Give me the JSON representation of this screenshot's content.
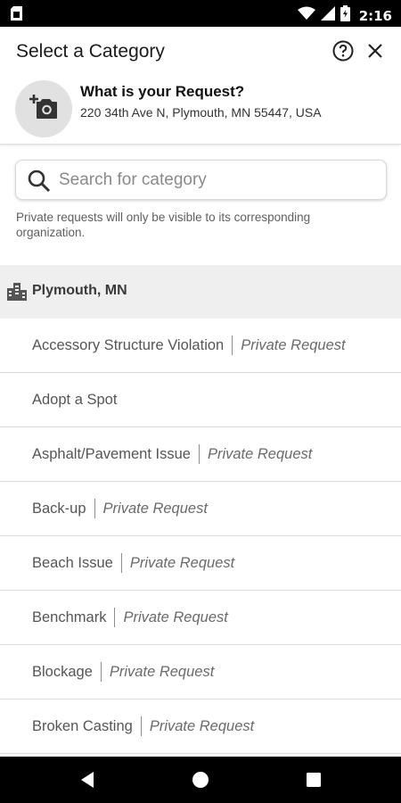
{
  "status_bar": {
    "time": "2:16",
    "icons": [
      "sim-card-icon",
      "wifi-icon",
      "signal-icon",
      "battery-icon"
    ]
  },
  "header": {
    "title": "Select a Category",
    "help_icon": "help-circle-icon",
    "close_icon": "close-icon",
    "photo_icon": "add-photo-icon",
    "request_title": "What is your Request?",
    "request_address": "220 34th Ave N, Plymouth, MN 55447, USA"
  },
  "search": {
    "placeholder": "Search for category",
    "value": ""
  },
  "note": "Private requests will only be visible to its corresponding organization.",
  "organization": {
    "name": "Plymouth, MN",
    "icon": "city-buildings-icon"
  },
  "categories": [
    {
      "label": "Accessory Structure Violation",
      "tag": "Private Request"
    },
    {
      "label": "Adopt a Spot",
      "tag": ""
    },
    {
      "label": "Asphalt/Pavement Issue",
      "tag": "Private Request"
    },
    {
      "label": "Back-up",
      "tag": "Private Request"
    },
    {
      "label": "Beach Issue",
      "tag": "Private Request"
    },
    {
      "label": "Benchmark",
      "tag": "Private Request"
    },
    {
      "label": "Blockage",
      "tag": "Private Request"
    },
    {
      "label": "Broken Casting",
      "tag": "Private Request"
    }
  ],
  "nav_bar": {
    "buttons": [
      "back-icon",
      "home-icon",
      "recents-icon"
    ]
  },
  "colors": {
    "status_bar_bg": "#000000",
    "org_header_bg": "#efefef",
    "photo_circle_bg": "#e1e1e1",
    "divider": "#dcdcdc"
  }
}
